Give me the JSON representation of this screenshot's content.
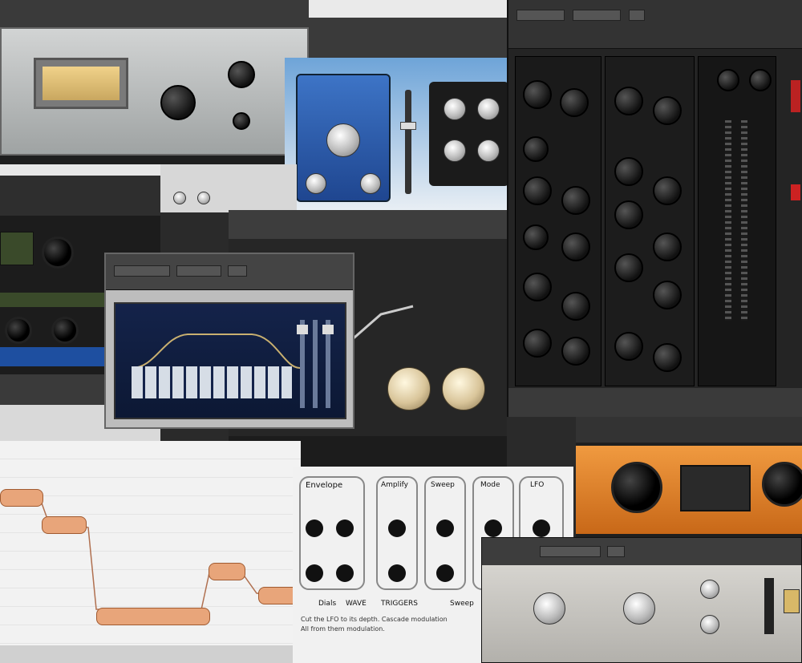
{
  "background": {
    "color": "#2a2a2a"
  },
  "top_center": {
    "header_label": ""
  },
  "tube_compressor": {
    "panel_color": "#b9bcbc",
    "vu_color": "#d8bc78"
  },
  "blue_pedal": {
    "color": "#2f5fb0"
  },
  "channel_strip": {
    "color": "#2b2b2b"
  },
  "eq_window": {
    "screen_color": "#1c2c55",
    "header": [
      "",
      "",
      ""
    ]
  },
  "cream_knobs": {
    "labels": [
      "",
      ""
    ]
  },
  "orange_unit": {
    "color": "#e47f22"
  },
  "melodyne": {
    "note_color": "#e8a57a"
  },
  "knob_grid": {
    "columns": [
      "Envelope",
      "Amplify",
      "Sweep",
      "Mode",
      "LFO"
    ],
    "footer": [
      "Dials",
      "WAVE",
      "TRIGGERS",
      "Sweep"
    ],
    "description": [
      "Cut the LFO to its depth. Cascade modulation",
      "All from them modulation."
    ]
  },
  "gray_compressor": {
    "panel_color": "#c9c7c2"
  }
}
